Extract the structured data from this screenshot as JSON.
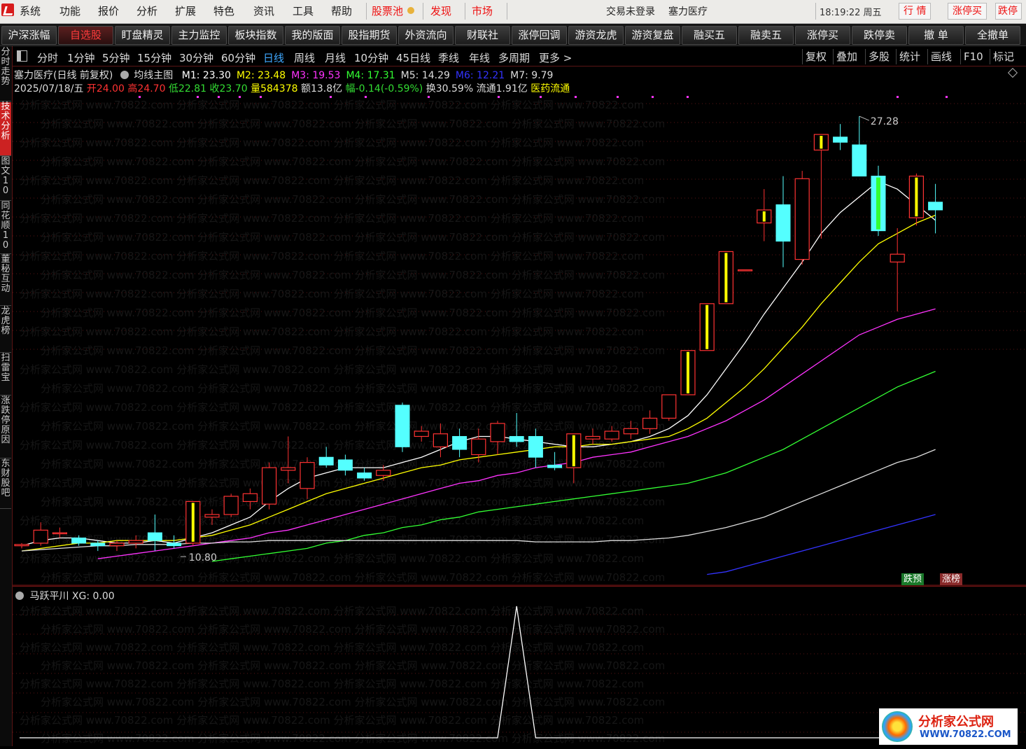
{
  "menubar": {
    "items": [
      "系统",
      "功能",
      "报价",
      "分析",
      "扩展",
      "特色",
      "资讯",
      "工具",
      "帮助"
    ],
    "red_items": [
      "股票池",
      "发现",
      "市场"
    ],
    "login_status": "交易未登录",
    "stock_name": "塞力医疗",
    "time": "18:19:22 周五",
    "right_tabs": [
      "行  情",
      "涨停买",
      "跌停"
    ]
  },
  "buttons": [
    "沪深涨幅",
    "自选股",
    "盯盘精灵",
    "主力监控",
    "板块指数",
    "我的版面",
    "股指期货",
    "外资流向",
    "财联社",
    "涨停回调",
    "游资龙虎",
    "游资复盘",
    "融买五",
    "融卖五",
    "涨停买",
    "跌停卖",
    "撤  单",
    "全撤单"
  ],
  "active_button": "自选股",
  "periods": [
    "分时",
    "1分钟",
    "5分钟",
    "15分钟",
    "30分钟",
    "60分钟",
    "日线",
    "周线",
    "月线",
    "10分钟",
    "45日线",
    "季线",
    "年线",
    "多周期",
    "更多 >"
  ],
  "selected_period": "日线",
  "right_tools": [
    "复权",
    "叠加",
    "多股",
    "统计",
    "画线",
    "F10",
    "标记"
  ],
  "left_tabs": [
    "分时走势",
    "技术分析",
    "图文10",
    "同花顺10",
    "董秘互动",
    "龙虎榜",
    "扫雷宝",
    "涨跌停原因",
    "东财股吧"
  ],
  "active_left_tab": "技术分析",
  "chart_header": {
    "title": "塞力医疗(日线 前复权)",
    "indicator": "均线主图",
    "ma": [
      {
        "label": "M1: 23.30",
        "color": "#ffffff"
      },
      {
        "label": "M2: 23.48",
        "color": "#ffff00"
      },
      {
        "label": "M3: 19.53",
        "color": "#ff33ff"
      },
      {
        "label": "M4: 17.31",
        "color": "#33ff33"
      },
      {
        "label": "M5: 14.29",
        "color": "#dddddd"
      },
      {
        "label": "M6: 12.21",
        "color": "#3333ff"
      },
      {
        "label": "M7: 9.79",
        "color": "#dddddd"
      }
    ]
  },
  "quote_line": {
    "date": "2025/07/18/五",
    "open_label": "开",
    "open": "24.00",
    "high_label": "高",
    "high": "24.70",
    "low_label": "低",
    "low": "22.81",
    "close_label": "收",
    "close": "23.70",
    "vol_label": "量",
    "vol": "584378",
    "amt_label": "额",
    "amt": "13.8亿",
    "chg_label": "幅",
    "chg": "-0.14(-0.59%)",
    "turn_label": "换",
    "turn": "30.59%",
    "float_label": "流通",
    "float": "1.91亿",
    "sector": "医药流通"
  },
  "annotations": {
    "max_price": "27.28",
    "min_price": "10.80",
    "badge_down": "跌预",
    "badge_up": "涨榜"
  },
  "sub_header": "马跃平川  XG: 0.00",
  "watermark_text": "分析家公式网 www.70822.com",
  "site_logo": {
    "title": "分析家公式网",
    "url": "WWW.70822.COM"
  },
  "colors": {
    "up": "#ff3232",
    "down": "#54ffff",
    "yang_line": "#ffff00",
    "bg": "#000000"
  },
  "chart_data": {
    "type": "candlestick",
    "candles": [
      [
        10.8,
        10.9,
        10.7,
        10.85
      ],
      [
        10.9,
        11.7,
        10.8,
        11.4
      ],
      [
        11.3,
        11.5,
        11.1,
        11.3
      ],
      [
        11.1,
        11.2,
        10.8,
        10.9
      ],
      [
        10.9,
        11.0,
        10.6,
        10.8
      ],
      [
        10.8,
        11.0,
        10.6,
        10.9
      ],
      [
        10.9,
        11.2,
        10.7,
        11.0
      ],
      [
        11.3,
        12.0,
        10.6,
        11.0
      ],
      [
        10.9,
        11.2,
        10.7,
        10.8
      ],
      [
        10.9,
        12.5,
        10.8,
        12.5
      ],
      [
        11.9,
        12.2,
        11.6,
        12.0
      ],
      [
        12.0,
        12.8,
        11.9,
        12.7
      ],
      [
        12.5,
        13.0,
        12.2,
        12.8
      ],
      [
        12.4,
        14.0,
        12.2,
        13.8
      ],
      [
        13.7,
        15.0,
        13.2,
        13.8
      ],
      [
        13.0,
        14.2,
        12.6,
        14.0
      ],
      [
        14.2,
        14.6,
        13.8,
        13.9
      ],
      [
        14.1,
        14.3,
        13.5,
        13.7
      ],
      [
        13.6,
        13.8,
        13.3,
        13.4
      ],
      [
        13.5,
        13.9,
        13.3,
        13.7
      ],
      [
        16.2,
        16.3,
        14.4,
        14.6
      ],
      [
        15.0,
        15.4,
        14.8,
        15.2
      ],
      [
        14.6,
        15.5,
        14.2,
        15.1
      ],
      [
        15.0,
        15.3,
        14.2,
        14.5
      ],
      [
        14.3,
        15.3,
        14.0,
        14.9
      ],
      [
        14.8,
        15.6,
        14.3,
        15.5
      ],
      [
        15.0,
        15.9,
        14.6,
        14.8
      ],
      [
        15.0,
        15.3,
        13.8,
        14.2
      ],
      [
        13.9,
        14.4,
        13.7,
        13.8
      ],
      [
        13.8,
        15.1,
        13.2,
        15.1
      ],
      [
        14.9,
        15.3,
        14.7,
        15.0
      ],
      [
        14.9,
        15.4,
        14.8,
        15.2
      ],
      [
        15.1,
        15.6,
        14.9,
        15.3
      ],
      [
        15.3,
        16.0,
        15.1,
        15.7
      ],
      [
        15.7,
        16.6,
        15.6,
        16.6
      ],
      [
        16.6,
        18.3,
        16.6,
        18.3
      ],
      [
        18.3,
        20.1,
        18.3,
        20.1
      ],
      [
        20.1,
        22.1,
        20.1,
        22.1
      ],
      [
        21.4,
        21.4,
        21.4,
        21.4
      ],
      [
        23.2,
        24.5,
        22.5,
        23.7
      ],
      [
        23.9,
        25.0,
        21.5,
        22.5
      ],
      [
        21.8,
        25.2,
        21.6,
        24.9
      ],
      [
        26.0,
        26.6,
        22.6,
        26.6
      ],
      [
        26.5,
        27.0,
        26.0,
        26.3
      ],
      [
        26.2,
        27.3,
        25.0,
        25.0
      ],
      [
        25.0,
        25.4,
        22.7,
        22.9
      ],
      [
        21.7,
        23.0,
        19.8,
        22.0
      ],
      [
        23.4,
        25.1,
        23.1,
        25.0
      ],
      [
        24.0,
        24.7,
        22.8,
        23.7
      ]
    ],
    "yang_line_indices": [
      9,
      29,
      35,
      36,
      37,
      39,
      42,
      47
    ],
    "ma_series": [
      {
        "name": "M1",
        "color": "#ffffff",
        "start": 0,
        "values": [
          10.8,
          11.0,
          11.1,
          11.1,
          11.0,
          10.9,
          10.9,
          11.0,
          10.9,
          11.1,
          11.3,
          11.6,
          11.9,
          12.5,
          13.0,
          13.4,
          13.6,
          13.8,
          13.8,
          13.8,
          14.0,
          14.2,
          14.5,
          14.8,
          15.0,
          15.0,
          14.9,
          14.8,
          14.7,
          14.6,
          14.6,
          14.7,
          14.8,
          15.0,
          15.3,
          15.8,
          16.6,
          17.6,
          18.6,
          19.7,
          20.7,
          21.7,
          22.8,
          23.6,
          24.2,
          24.8,
          24.5,
          23.9,
          23.3
        ]
      },
      {
        "name": "M2",
        "color": "#ffff00",
        "start": 0,
        "values": [
          10.6,
          10.7,
          10.8,
          10.9,
          10.9,
          11.0,
          11.0,
          11.0,
          11.0,
          11.1,
          11.2,
          11.4,
          11.6,
          11.9,
          12.2,
          12.5,
          12.8,
          13.0,
          13.2,
          13.4,
          13.6,
          13.8,
          13.9,
          14.1,
          14.2,
          14.3,
          14.4,
          14.5,
          14.6,
          14.6,
          14.7,
          14.7,
          14.8,
          14.9,
          15.0,
          15.3,
          15.7,
          16.3,
          16.9,
          17.6,
          18.4,
          19.2,
          20.1,
          20.9,
          21.7,
          22.4,
          22.8,
          23.2,
          23.5
        ]
      },
      {
        "name": "M3",
        "color": "#ff33ff",
        "start": 4,
        "values": [
          10.3,
          10.4,
          10.5,
          10.6,
          10.7,
          10.8,
          10.9,
          11.0,
          11.1,
          11.3,
          11.4,
          11.6,
          11.8,
          12.0,
          12.2,
          12.4,
          12.6,
          12.8,
          13.0,
          13.2,
          13.3,
          13.5,
          13.6,
          13.8,
          13.9,
          14.0,
          14.2,
          14.3,
          14.4,
          14.6,
          14.8,
          15.0,
          15.3,
          15.6,
          16.0,
          16.4,
          16.9,
          17.4,
          17.9,
          18.4,
          18.9,
          19.2,
          19.5,
          19.7,
          19.9
        ]
      },
      {
        "name": "M4",
        "color": "#33ff33",
        "start": 10,
        "values": [
          10.2,
          10.3,
          10.4,
          10.5,
          10.6,
          10.7,
          10.9,
          11.0,
          11.2,
          11.3,
          11.5,
          11.6,
          11.8,
          11.9,
          12.1,
          12.2,
          12.3,
          12.4,
          12.5,
          12.6,
          12.7,
          12.8,
          12.9,
          13.0,
          13.1,
          13.2,
          13.4,
          13.6,
          13.9,
          14.2,
          14.5,
          14.9,
          15.3,
          15.7,
          16.1,
          16.5,
          16.9,
          17.2,
          17.5
        ]
      },
      {
        "name": "M5",
        "color": "#dddddd",
        "start": 0,
        "values": [
          10.6,
          10.65,
          10.7,
          10.75,
          10.8,
          10.8,
          10.85,
          10.85,
          10.85,
          10.9,
          10.9,
          10.95,
          10.95,
          11.0,
          11.0,
          11.0,
          11.0,
          11.0,
          11.0,
          11.0,
          11.0,
          11.0,
          11.0,
          11.0,
          11.0,
          11.0,
          11.0,
          10.95,
          10.95,
          10.95,
          10.95,
          11.0,
          11.0,
          11.05,
          11.1,
          11.2,
          11.35,
          11.5,
          11.7,
          11.9,
          12.2,
          12.5,
          12.8,
          13.1,
          13.4,
          13.7,
          14.0,
          14.2,
          14.5
        ]
      },
      {
        "name": "M6",
        "color": "#3333ff",
        "start": 36,
        "values": [
          9.7,
          9.8,
          10.0,
          10.2,
          10.4,
          10.6,
          10.8,
          11.0,
          11.2,
          11.4,
          11.6,
          11.8,
          12.0
        ]
      }
    ],
    "sub_indicator": {
      "name": "马跃平川",
      "values_nonzero": [
        {
          "index": 26,
          "value": 1
        }
      ]
    }
  }
}
